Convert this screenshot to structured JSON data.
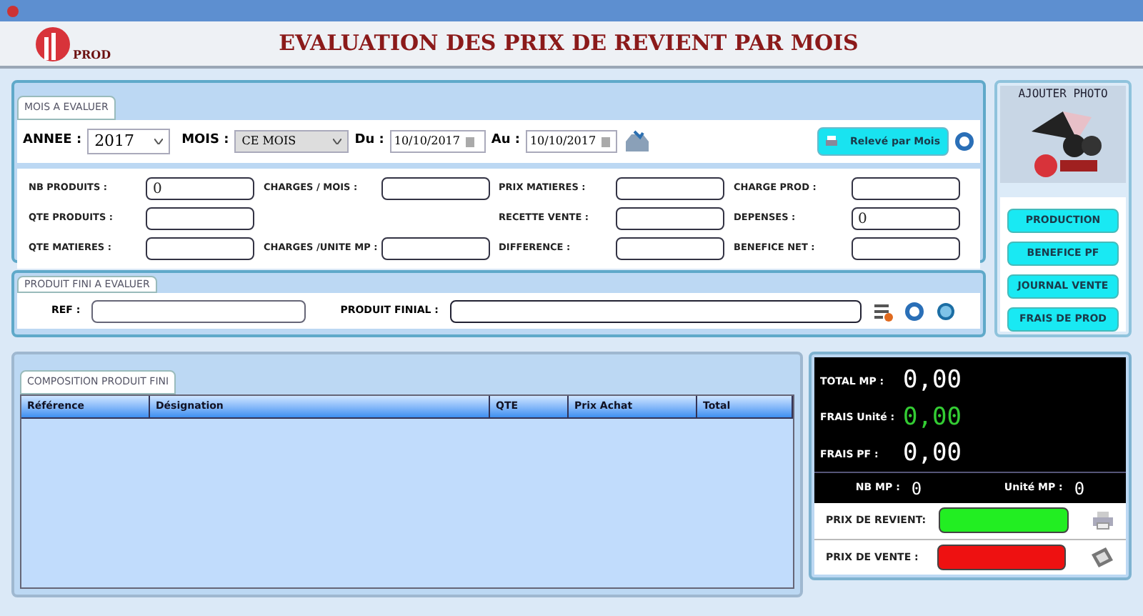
{
  "header": {
    "logo_text": "PROD",
    "title": "EVALUATION DES PRIX DE REVIENT PAR MOIS"
  },
  "period": {
    "tab": "MOIS A EVALUER",
    "year_label": "ANNEE :",
    "year": "2017",
    "month_label": "MOIS :",
    "month": "CE MOIS",
    "from_label": "Du :",
    "from": "10/10/2017",
    "to_label": "Au :",
    "to": "10/10/2017",
    "report_button": "Relevé par Mois"
  },
  "field_columns": [
    [
      {
        "label": "NB PRODUITS :",
        "value": "0"
      },
      {
        "label": "QTE PRODUITS :"
      },
      {
        "label": "QTE MATIERES :"
      }
    ],
    [
      {
        "label": "CHARGES  /  MOIS :"
      },
      {
        "label": "CHARGES /UNITE MP :"
      }
    ],
    [
      {
        "label": "PRIX  MATIERES :"
      },
      {
        "label": "RECETTE VENTE :"
      },
      {
        "label": "DIFFERENCE :"
      }
    ],
    [
      {
        "label": "CHARGE PROD :"
      },
      {
        "label": "DEPENSES :",
        "value": "0"
      },
      {
        "label": "BENEFICE NET :"
      }
    ]
  ],
  "product": {
    "tab": "PRODUIT FINI A EVALUER",
    "ref_label": "REF :",
    "product_label": "PRODUIT  FINIAL :"
  },
  "photo": {
    "caption": "AJOUTER PHOTO"
  },
  "side_buttons": [
    "PRODUCTION",
    "BENEFICE  PF",
    "JOURNAL VENTE",
    "FRAIS DE PROD"
  ],
  "composition": {
    "tab": "COMPOSITION PRODUIT FINI",
    "columns": [
      "Référence",
      "Désignation",
      "QTE",
      "Prix Achat",
      "Total"
    ]
  },
  "totals": {
    "readouts": [
      {
        "label": "TOTAL  MP :",
        "value": "0,00",
        "color": "#ffffff"
      },
      {
        "label": "FRAIS Unité :",
        "value": "0,00",
        "color": "#33cc33"
      },
      {
        "label": "FRAIS   PF :",
        "value": "0,00",
        "color": "#ffffff"
      }
    ],
    "counters": [
      {
        "label": "NB MP :",
        "value": "0"
      },
      {
        "label": "Unité MP :",
        "value": "0"
      }
    ],
    "prices": [
      {
        "label": "PRIX DE REVIENT:",
        "color": "#22ee22"
      },
      {
        "label": "PRIX DE VENTE :",
        "color": "#ee1111"
      }
    ]
  }
}
